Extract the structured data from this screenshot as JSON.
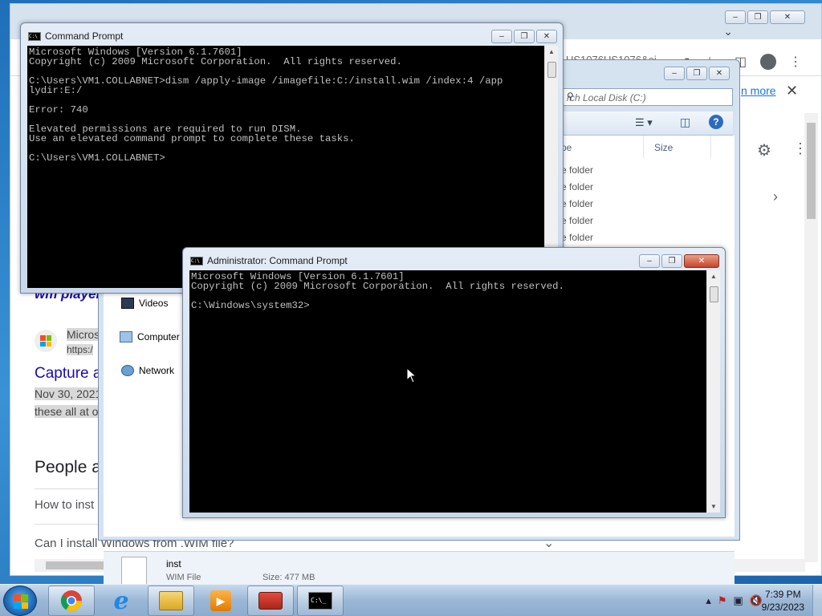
{
  "browser": {
    "url_fragment": "US1076US1076&ei",
    "learn_more": "n more",
    "results": {
      "wm_player": "wm player",
      "microsoft_text": "Micros",
      "https_text": "https:/",
      "capture_title": "Capture a",
      "date_text": "Nov 30, 2021",
      "snippet": "these all at o",
      "people_also_ask": "People a",
      "q1": "How to inst",
      "q2": "Can I install Windows from .WIM file?"
    }
  },
  "explorer": {
    "search_placeholder": "rch Local Disk (C:)",
    "columns": {
      "type": "pe",
      "size": "Size"
    },
    "rows": [
      "e folder",
      "e folder",
      "e folder",
      "e folder",
      "e folder"
    ],
    "nav": [
      {
        "label": "Videos"
      },
      {
        "label": "Computer"
      },
      {
        "label": "Network"
      }
    ],
    "details": {
      "name": "inst",
      "type": "WIM File",
      "size": "Size: 477 MB"
    }
  },
  "cmd1": {
    "title": "Command Prompt",
    "lines": "Microsoft Windows [Version 6.1.7601]\nCopyright (c) 2009 Microsoft Corporation.  All rights reserved.\n\nC:\\Users\\VM1.COLLABNET>dism /apply-image /imagefile:C:/install.wim /index:4 /app\nlydir:E:/\n\nError: 740\n\nElevated permissions are required to run DISM.\nUse an elevated command prompt to complete these tasks.\n\nC:\\Users\\VM1.COLLABNET>"
  },
  "cmd2": {
    "title": "Administrator:  Command Prompt",
    "lines": "Microsoft Windows [Version 6.1.7601]\nCopyright (c) 2009 Microsoft Corporation.  All rights reserved.\n\nC:\\Windows\\system32>"
  },
  "taskbar": {
    "apps": [
      {
        "name": "chrome"
      },
      {
        "name": "internet-explorer"
      },
      {
        "name": "file-explorer"
      },
      {
        "name": "media-player"
      },
      {
        "name": "toolbox"
      },
      {
        "name": "command-prompt"
      }
    ],
    "time": "7:39 PM",
    "date": "9/23/2023"
  },
  "colors": {
    "console_bg": "#000000",
    "console_fg": "#c0c0c0",
    "link": "#1a0dab"
  }
}
